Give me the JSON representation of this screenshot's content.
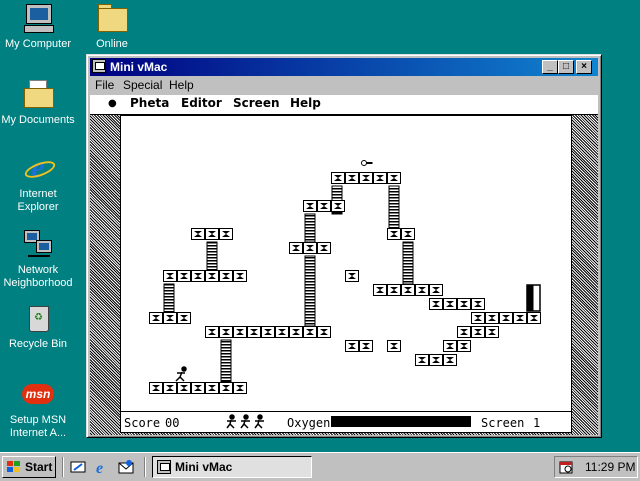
{
  "desktop": {
    "icons": [
      {
        "label": "My Computer",
        "icon": "my-computer-icon"
      },
      {
        "label": "Online",
        "icon": "folder-icon"
      },
      {
        "label": "My Documents",
        "icon": "my-documents-icon"
      },
      {
        "label": "Internet Explorer",
        "icon": "internet-explorer-icon"
      },
      {
        "label": "Network Neighborhood",
        "icon": "network-neighborhood-icon"
      },
      {
        "label": "Recycle Bin",
        "icon": "recycle-bin-icon"
      },
      {
        "label": "Setup MSN Internet A...",
        "icon": "msn-icon"
      }
    ],
    "background": "#008080"
  },
  "window": {
    "title": "Mini vMac",
    "controls": {
      "minimize": "_",
      "maximize": "□",
      "close": "×"
    },
    "menu": {
      "file": "File",
      "special": "Special",
      "help": "Help"
    }
  },
  "mac": {
    "menu": {
      "apple": "",
      "app": "Pheta",
      "editor": "Editor",
      "screen": "Screen",
      "help": "Help"
    },
    "apple_glyph": "●",
    "game": {
      "score_label": "Score",
      "score_value": "00",
      "lives": 3,
      "oxygen_label": "Oxygen",
      "oxygen_level": 1.0,
      "screen_label": "Screen",
      "screen_number": "1"
    }
  },
  "taskbar": {
    "start_label": "Start",
    "quick_launch": [
      "desktop-icon",
      "internet-explorer-icon",
      "outlook-express-icon"
    ],
    "task_label": "Mini vMac",
    "clock": "11:29 PM"
  }
}
